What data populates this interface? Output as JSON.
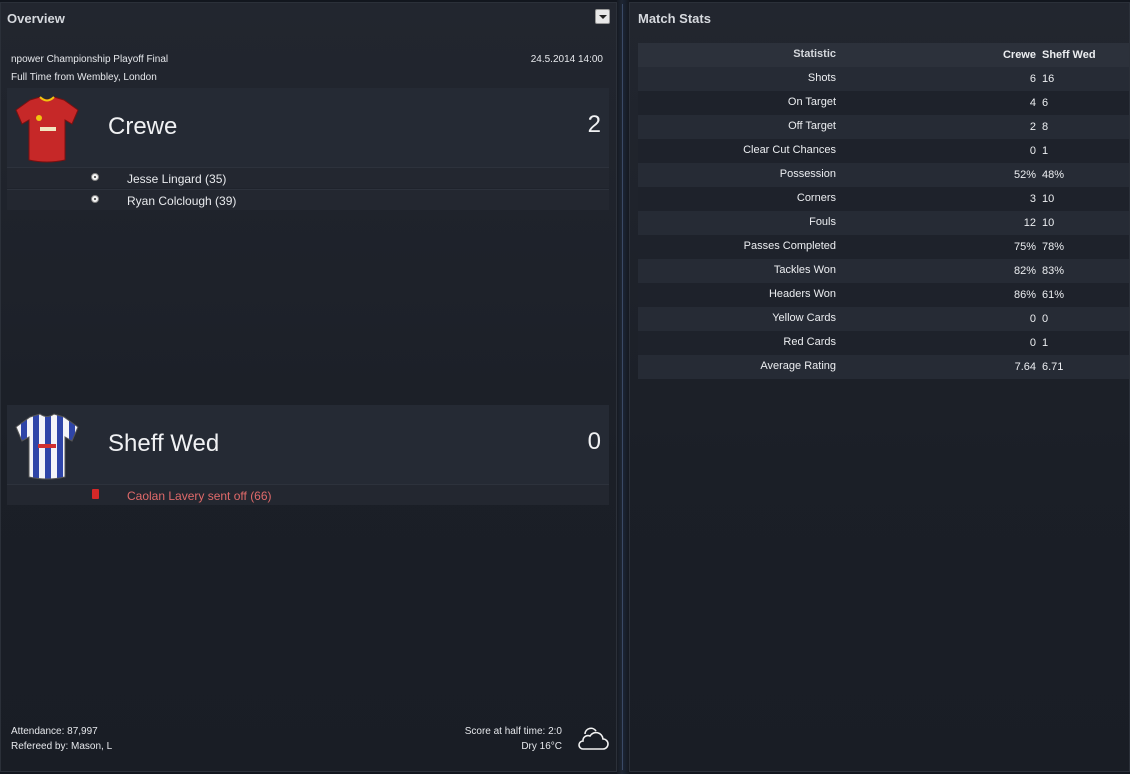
{
  "overview": {
    "title": "Overview",
    "competition": "npower Championship Playoff Final",
    "datetime": "24.5.2014 14:00",
    "status": "Full Time from Wembley, London",
    "home": {
      "name": "Crewe",
      "score": "2",
      "kit_color": "#c62828",
      "events": [
        {
          "type": "goal-icon",
          "text": "Jesse Lingard (35)"
        },
        {
          "type": "goal-icon",
          "text": "Ryan Colclough (39)"
        }
      ]
    },
    "away": {
      "name": "Sheff Wed",
      "score": "0",
      "kit_color": "#3b4fb0",
      "events": [
        {
          "type": "red-card-icon",
          "text": "Caolan Lavery sent off (66)"
        }
      ]
    },
    "attendance": "Attendance: 87,997",
    "referee": "Refereed by: Mason, L",
    "half_time": "Score at half time: 2:0",
    "weather": "Dry 16°C",
    "weather_icon": "cloud-icon"
  },
  "stats": {
    "title": "Match Stats",
    "headers": {
      "statistic": "Statistic",
      "home": "Crewe",
      "away": "Sheff Wed"
    },
    "rows": [
      {
        "label": "Shots",
        "home": "6",
        "away": "16"
      },
      {
        "label": "On Target",
        "home": "4",
        "away": "6"
      },
      {
        "label": "Off Target",
        "home": "2",
        "away": "8"
      },
      {
        "label": "Clear Cut Chances",
        "home": "0",
        "away": "1"
      },
      {
        "label": "Possession",
        "home": "52%",
        "away": "48%"
      },
      {
        "label": "Corners",
        "home": "3",
        "away": "10"
      },
      {
        "label": "Fouls",
        "home": "12",
        "away": "10"
      },
      {
        "label": "Passes Completed",
        "home": "75%",
        "away": "78%"
      },
      {
        "label": "Tackles Won",
        "home": "82%",
        "away": "83%"
      },
      {
        "label": "Headers Won",
        "home": "86%",
        "away": "61%"
      },
      {
        "label": "Yellow Cards",
        "home": "0",
        "away": "0"
      },
      {
        "label": "Red Cards",
        "home": "0",
        "away": "1"
      },
      {
        "label": "Average Rating",
        "home": "7.64",
        "away": "6.71"
      }
    ]
  },
  "colors": {
    "background": "#12161e",
    "panel": "#22262f",
    "red_event_text": "#e06a6a"
  }
}
